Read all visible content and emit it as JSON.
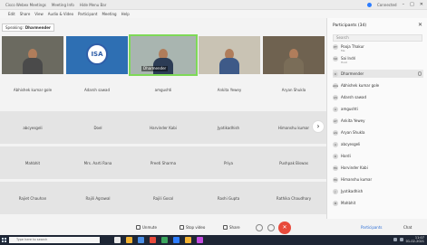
{
  "titlebar": {
    "tabs": [
      "Cisco Webex Meetings",
      "Meeting Info",
      "Hide Menu Bar"
    ],
    "connection": "Connected",
    "window_controls": [
      "–",
      "□",
      "✕"
    ]
  },
  "menubar": {
    "items": [
      "Edit",
      "Share",
      "View",
      "Audio & Video",
      "Participant",
      "Meeting",
      "Help"
    ]
  },
  "speaking": {
    "label": "Speaking:",
    "name": "Dharmender"
  },
  "strip": [
    {
      "tag": "",
      "active": false,
      "kind": "person",
      "shirt": "#4a4a4a",
      "bg": "#6b6a60"
    },
    {
      "tag": "",
      "active": false,
      "kind": "logo",
      "logo": "ISA",
      "bg": "#2e6fb3"
    },
    {
      "tag": "Dharmender",
      "active": true,
      "kind": "person",
      "shirt": "#2c3c55",
      "bg": "#a9b5b0"
    },
    {
      "tag": "",
      "active": false,
      "kind": "person",
      "shirt": "#3e5a88",
      "bg": "#c9c3b4"
    },
    {
      "tag": "",
      "active": false,
      "kind": "person",
      "shirt": "#7a6d58",
      "bg": "#6f6250"
    }
  ],
  "strip_names": [
    "Abhishek kumar gole",
    "Adarsh sawad",
    "amgushti",
    "Ankita Yewey",
    "Aryan Shukla"
  ],
  "tiles": [
    [
      "abcyesgeli",
      "Doel",
      "Harvinder Kabi",
      "Jyotikadhish",
      "Himanshu kumar"
    ],
    [
      "Mahbhit",
      "Mrs. Aarti Rana",
      "Preeti Sharma",
      "Priya",
      "Pushpak Biswas"
    ],
    [
      "Rajiet Chauhan",
      "Rajili Agrawal",
      "Rajili Gosal",
      "Rashi Gupta",
      "Rathika Chaudhary"
    ]
  ],
  "panel": {
    "title": "Participants (34)",
    "close": "✕",
    "search_placeholder": "Search",
    "host": {
      "initials": "PT",
      "name": "Pooja Thakur",
      "role": "Me"
    },
    "cohost": {
      "initials": "SD",
      "name": "Sai Indri",
      "role": "Host"
    },
    "people": [
      {
        "initials": "D",
        "name": "Dharmender"
      },
      {
        "initials": "AKG",
        "name": "Abhishek kumar gole"
      },
      {
        "initials": "AS",
        "name": "Adarsh sawad"
      },
      {
        "initials": "A",
        "name": "amgushti"
      },
      {
        "initials": "AY",
        "name": "Ankita Yewey"
      },
      {
        "initials": "AS",
        "name": "Aryan Shukla"
      },
      {
        "initials": "A",
        "name": "abcyesgeli"
      },
      {
        "initials": "D",
        "name": "Hardi"
      },
      {
        "initials": "HK",
        "name": "Harvinder Kabi"
      },
      {
        "initials": "HK",
        "name": "Himanshu kumar"
      },
      {
        "initials": "J",
        "name": "Jyotikadhish"
      },
      {
        "initials": "M",
        "name": "Mahbhit"
      }
    ]
  },
  "controls": {
    "unmute": "Unmute",
    "stop_video": "Stop video",
    "share": "Share",
    "leave": "✕",
    "participants": "Participants",
    "chat": "Chat"
  },
  "taskbar": {
    "search_placeholder": "Type here to search",
    "icon_colors": [
      "#e8e8e8",
      "#f2b233",
      "#4a8ee6",
      "#e84b3c",
      "#3ba55d",
      "#2d7dff",
      "#f2b233",
      "#c44be0"
    ],
    "time": "11:07",
    "date": "01-02-2021"
  },
  "colors": {
    "active_outline": "#7ed957",
    "leave": "#e84b3c",
    "accent": "#2d6fd6"
  }
}
